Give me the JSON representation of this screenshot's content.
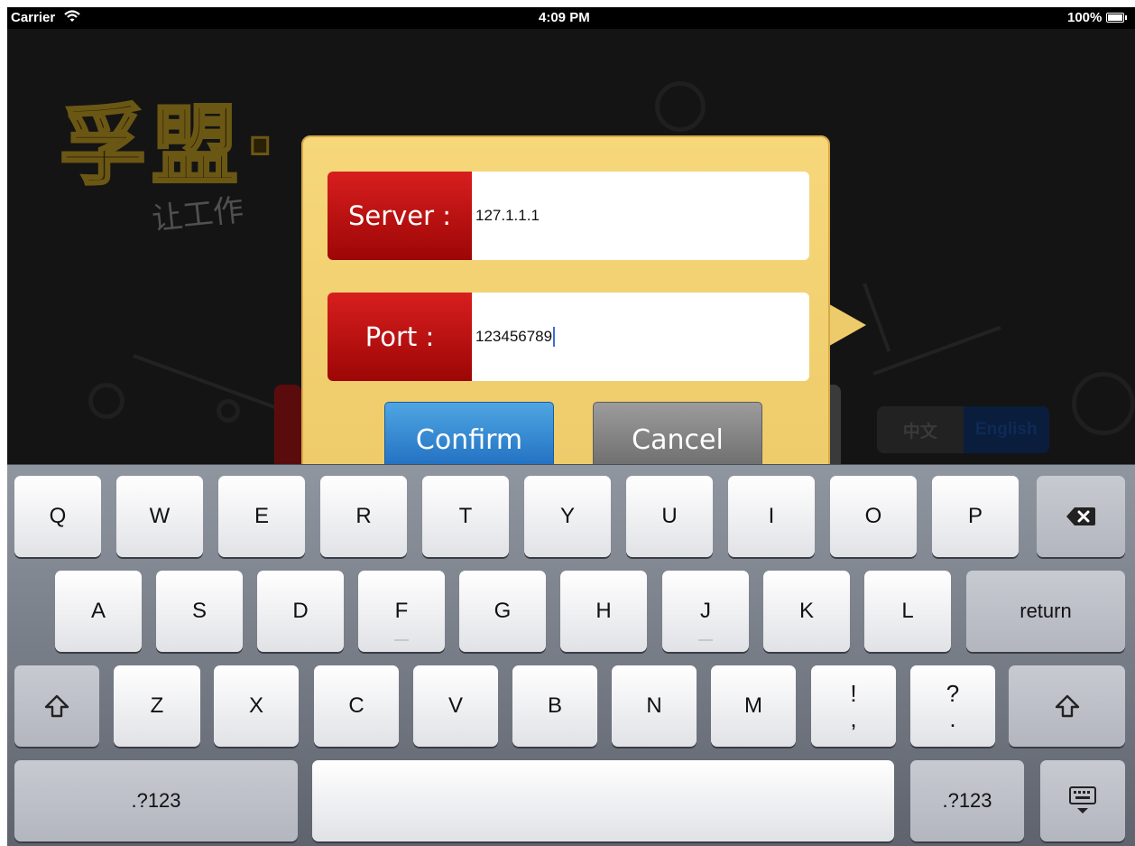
{
  "status_bar": {
    "carrier": "Carrier",
    "time": "4:09 PM",
    "battery": "100%"
  },
  "background": {
    "logo": "孚盟·",
    "slogan": "让工作",
    "language_toggle": {
      "chinese": "中文",
      "english": "English"
    }
  },
  "dialog": {
    "server_label": "Server :",
    "server_value": "127.1.1.1",
    "port_label": "Port :",
    "port_value": "123456789",
    "confirm_label": "Confirm",
    "cancel_label": "Cancel"
  },
  "keyboard": {
    "row1": [
      "Q",
      "W",
      "E",
      "R",
      "T",
      "Y",
      "U",
      "I",
      "O",
      "P"
    ],
    "row2": [
      "A",
      "S",
      "D",
      "F",
      "G",
      "H",
      "J",
      "K",
      "L"
    ],
    "row3": [
      "Z",
      "X",
      "C",
      "V",
      "B",
      "N",
      "M"
    ],
    "return_label": "return",
    "punct_left_top": "!",
    "punct_left_bottom": ",",
    "punct_right_top": "?",
    "punct_right_bottom": ".",
    "numbers_label_left": ".?123",
    "numbers_label_right": ".?123",
    "icons": [
      "backspace-icon",
      "shift-icon",
      "keyboard-dismiss-icon",
      "wifi-icon",
      "battery-icon"
    ]
  }
}
